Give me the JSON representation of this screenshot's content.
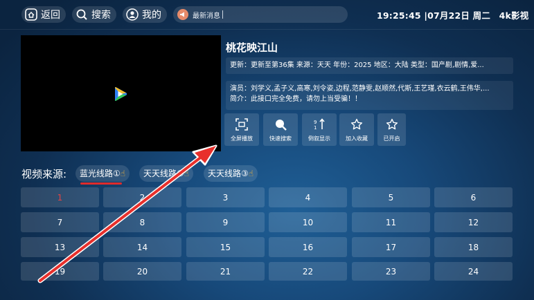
{
  "header": {
    "back_label": "返回",
    "search_label": "搜索",
    "mine_label": "我的",
    "news_label": "最新消息",
    "clock": "19:25:45 |07月22日 周二",
    "brand": "4k影视",
    "icons": [
      "home-icon",
      "search-icon",
      "user-icon",
      "megaphone-icon"
    ]
  },
  "video": {
    "title": "桃花映江山",
    "meta": "更新：更新至第36集  来源：天天  年份：2025  地区：大陆  类型：国产剧,剧情,爱...",
    "cast": "演员：刘学义,孟子义,高寒,刘令姿,边程,范静雯,赵顺然,代斯,王艺瑾,衣云鹤,王伟华,...",
    "intro": "简介：此接口完全免费，请勿上当受骗！！"
  },
  "actions": [
    {
      "label": "全屏播放",
      "icon": "fullscreen-icon"
    },
    {
      "label": "快速搜索",
      "icon": "search-icon"
    },
    {
      "label": "倒叙显示",
      "icon": "sort-icon"
    },
    {
      "label": "加入收藏",
      "icon": "star-icon"
    },
    {
      "label": "已开启",
      "icon": "star-icon"
    }
  ],
  "sources": {
    "label": "视频来源:",
    "items": [
      "蓝光线路①",
      "天天线路②",
      "天天线路③"
    ],
    "selected_index": 0,
    "pointer_icon": "☝"
  },
  "episodes": [
    "1",
    "2",
    "3",
    "4",
    "5",
    "6",
    "7",
    "8",
    "9",
    "10",
    "11",
    "12",
    "13",
    "14",
    "15",
    "16",
    "17",
    "18",
    "19",
    "20",
    "21",
    "22",
    "23",
    "24"
  ],
  "active_episode": "1",
  "colors": {
    "accent_red": "#e02b2b",
    "arrow_red": "#e8302c",
    "background": "#17497a"
  }
}
